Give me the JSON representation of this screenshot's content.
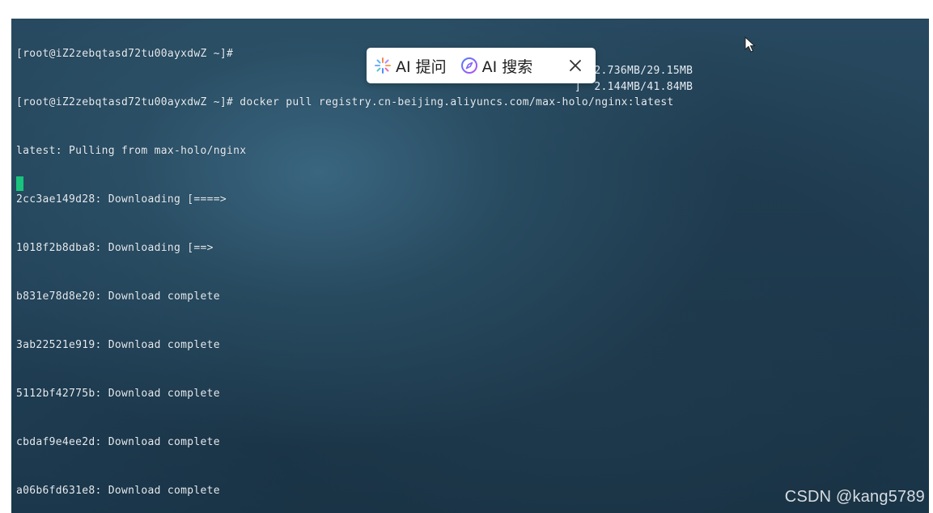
{
  "terminal": {
    "lines": [
      "[root@iZ2zebqtasd72tu00ayxdwZ ~]#",
      "[root@iZ2zebqtasd72tu00ayxdwZ ~]# docker pull registry.cn-beijing.aliyuncs.com/max-holo/nginx:latest",
      "latest: Pulling from max-holo/nginx",
      "2cc3ae149d28: Downloading [====>",
      "1018f2b8dba8: Downloading [==>",
      "b831e78d8e20: Download complete",
      "3ab22521e919: Download complete",
      "5112bf42775b: Download complete",
      "cbdaf9e4ee2d: Download complete",
      "a06b6fd631e8: Download complete"
    ],
    "progress_right": [
      "]  2.736MB/29.15MB",
      "]  2.144MB/41.84MB"
    ],
    "cursor_color": "#19c37d"
  },
  "ai_toolbar": {
    "ask_label": "AI 提问",
    "search_label": "AI 搜索",
    "ask_icon": "sparkle-icon",
    "search_icon": "compass-icon",
    "close_icon": "close-icon"
  },
  "watermark": "CSDN @kang5789"
}
